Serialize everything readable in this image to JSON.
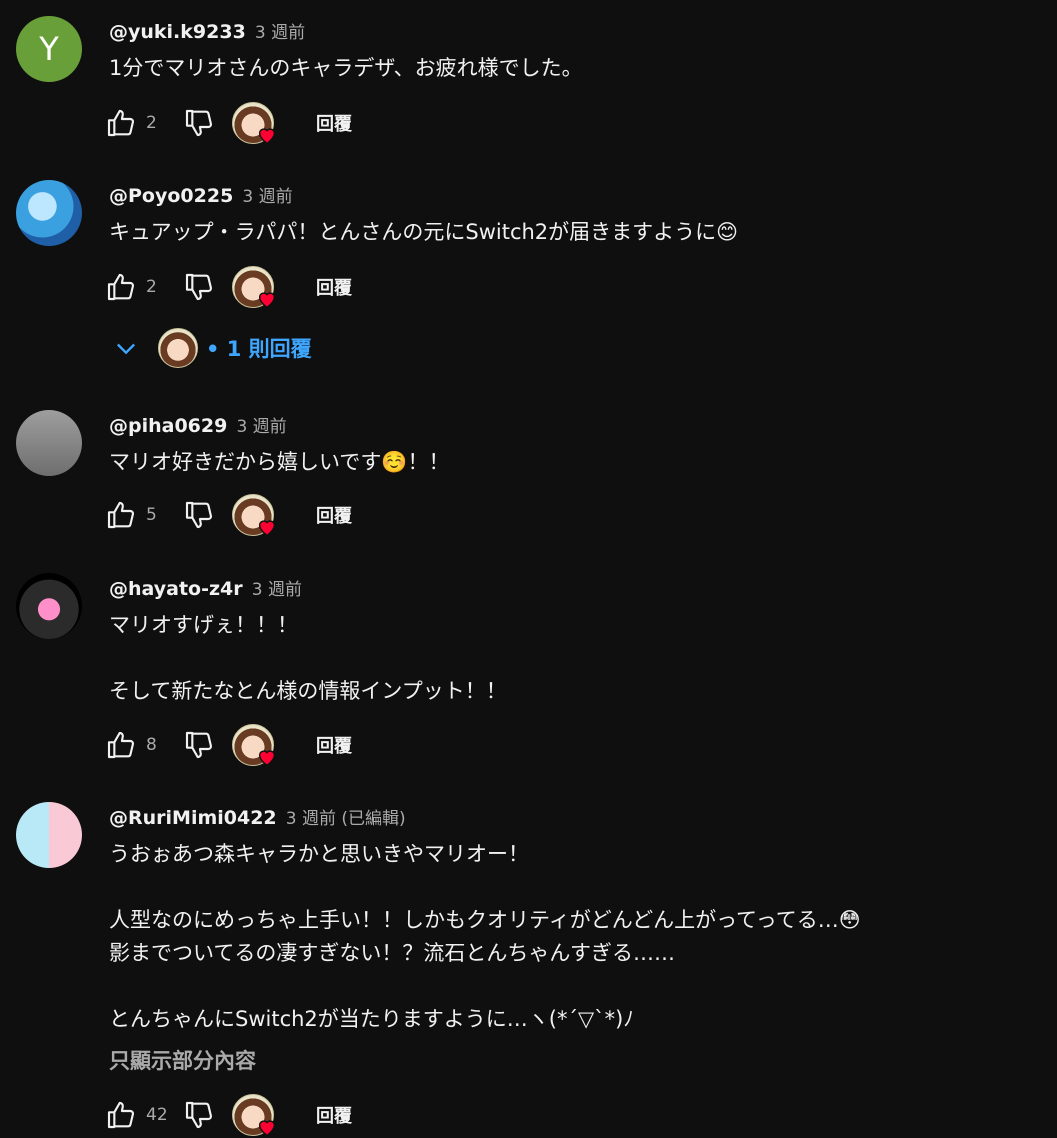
{
  "reply_label": "回覆",
  "comments": [
    {
      "user": "@yuki.k9233",
      "time": "3 週前",
      "avatar_letter": "Y",
      "text": "1分でマリオさんのキャラデザ、お疲れ様でした。",
      "likes": "2"
    },
    {
      "user": "@Poyo0225",
      "time": "3 週前",
      "text": "キュアップ・ラパパ！とんさんの元にSwitch2が届きますように😊",
      "likes": "2",
      "replies_label": "• 1 則回覆"
    },
    {
      "user": "@piha0629",
      "time": "3 週前",
      "text": "マリオ好きだから嬉しいです☺️！！",
      "likes": "5"
    },
    {
      "user": "@hayato-z4r",
      "time": "3 週前",
      "text": "マリオすげぇ！！！\n\nそして新たなとん様の情報インプット！！",
      "likes": "8"
    },
    {
      "user": "@RuriMimi0422",
      "time": "3 週前 (已編輯)",
      "text": "うおぉあつ森キャラかと思いきやマリオー！\n\n人型なのにめっちゃ上手い！！しかもクオリティがどんどん上がってってる…😳\n影までついてるの凄すぎない！？流石とんちゃんすぎる……\n\nとんちゃんにSwitch2が当たりますように…ヽ(*´▽`*)ﾉ",
      "show_more": "只顯示部分內容",
      "likes": "42"
    }
  ],
  "colors": {
    "background": "#0f0f0f",
    "text": "#f1f1f1",
    "muted": "#aaaaaa",
    "link": "#3ea6ff",
    "heart": "#ff0033"
  }
}
